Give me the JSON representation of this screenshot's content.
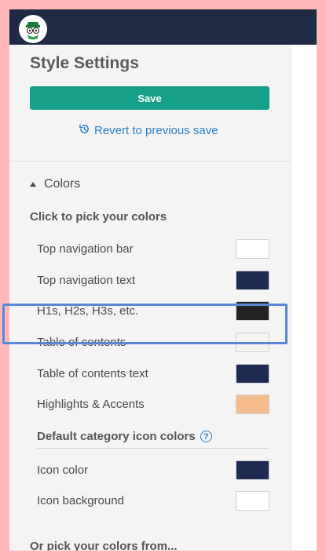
{
  "panel": {
    "title": "Style Settings",
    "save_label": "Save",
    "revert_label": "Revert to previous save"
  },
  "colors_section": {
    "heading": "Colors",
    "subheading": "Click to pick your colors",
    "items": [
      {
        "label": "Top navigation bar",
        "color": "#ffffff"
      },
      {
        "label": "Top navigation text",
        "color": "#1e2a52"
      },
      {
        "label": "H1s, H2s, H3s, etc.",
        "color": "#222222"
      },
      {
        "label": "Table of contents",
        "color": "#f5f3ef"
      },
      {
        "label": "Table of contents text",
        "color": "#1e2a52"
      },
      {
        "label": "Highlights & Accents",
        "color": "#f6bd8c"
      }
    ]
  },
  "category_icons": {
    "heading": "Default category icon colors",
    "info_icon": "info-icon",
    "items": [
      {
        "label": "Icon color",
        "color": "#1e2a52"
      },
      {
        "label": "Icon background",
        "color": "#ffffff"
      }
    ]
  },
  "or_pick_label": "Or pick your colors from...",
  "theme": {
    "topbar": "#1f2a44",
    "accent": "#16a08b",
    "link": "#2a7fc4",
    "highlight": "#5b86d6"
  }
}
